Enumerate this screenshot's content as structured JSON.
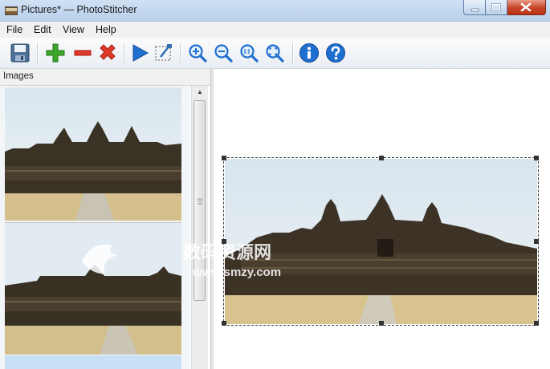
{
  "window": {
    "title": "Pictures* — PhotoStitcher"
  },
  "menu": {
    "items": [
      "File",
      "Edit",
      "View",
      "Help"
    ]
  },
  "toolbar": {
    "icons": [
      "save-icon",
      "add-icon",
      "remove-icon",
      "delete-icon",
      "play-icon",
      "crop-icon",
      "zoom-in-icon",
      "zoom-out-icon",
      "zoom-actual-icon",
      "zoom-fit-icon",
      "info-icon",
      "help-icon"
    ]
  },
  "images_panel": {
    "header": "Images"
  },
  "watermark": {
    "brand": "数码资源网",
    "url": "www.smzy.com"
  },
  "colors": {
    "title_bar": "#c8dbf0",
    "close_button": "#c74327",
    "accent_blue": "#1f6fd0",
    "add_green": "#3aa72b",
    "remove_red": "#e03a2a"
  }
}
